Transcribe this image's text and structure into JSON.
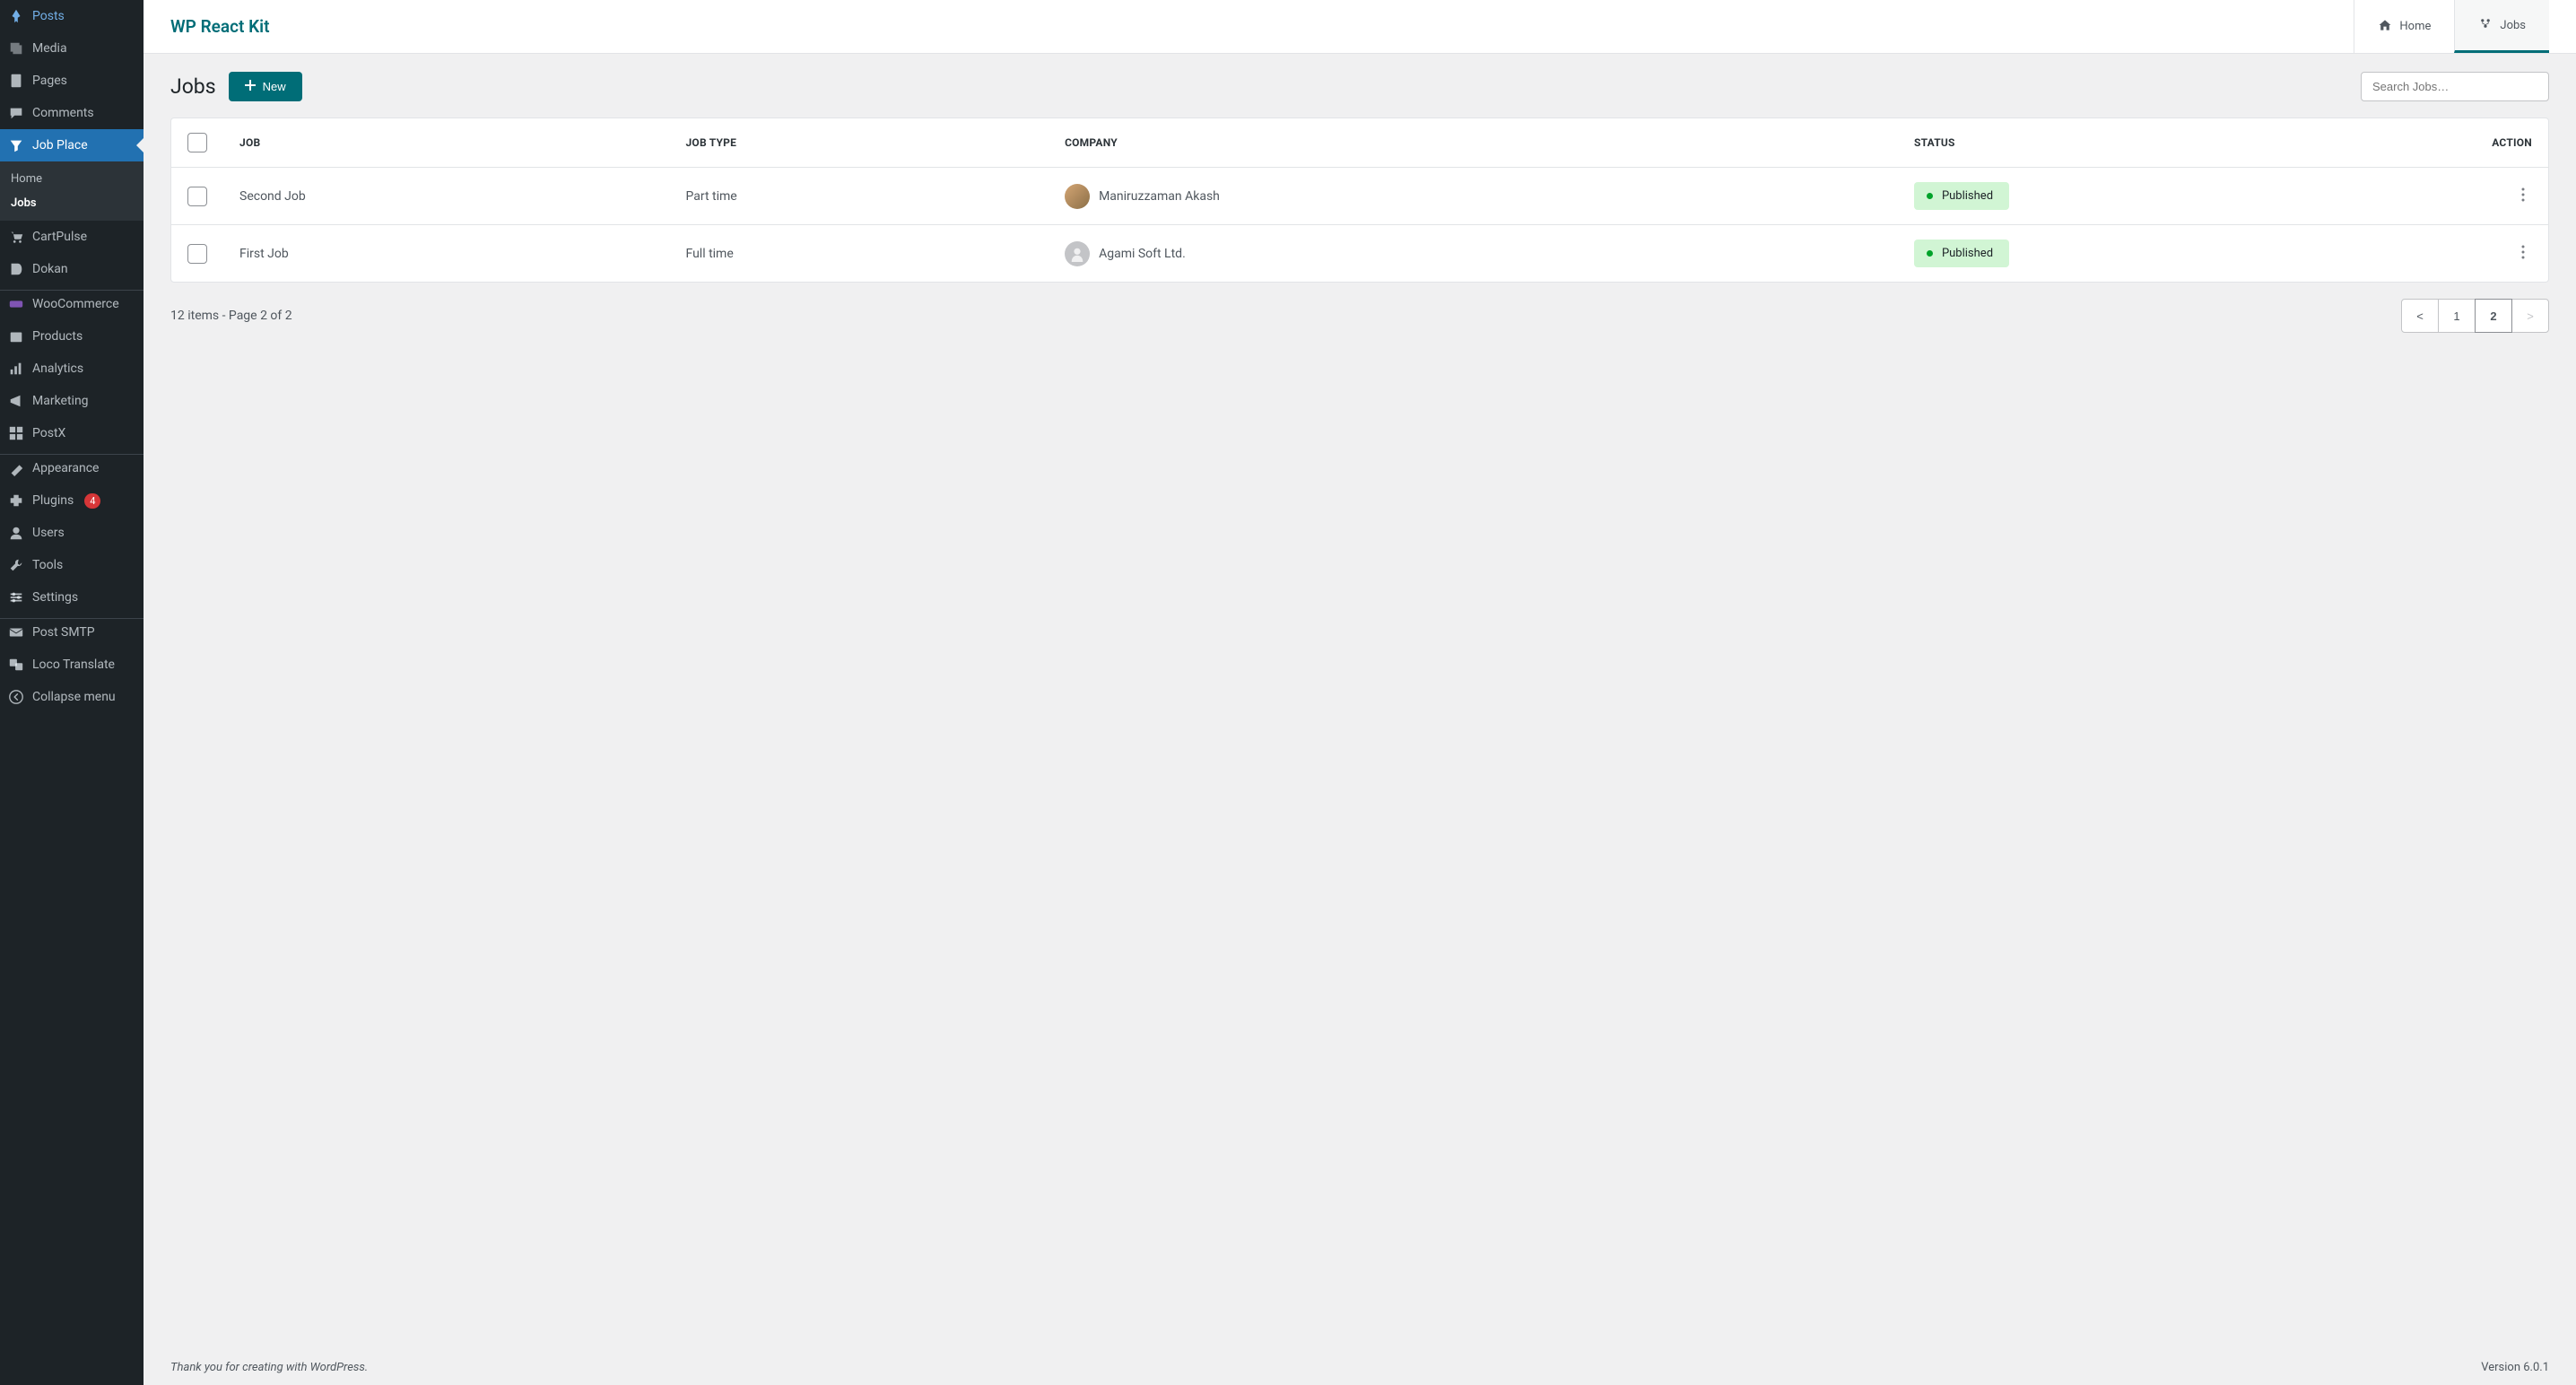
{
  "sidebar": {
    "items": [
      {
        "label": "Posts",
        "icon": "pin"
      },
      {
        "label": "Media",
        "icon": "media"
      },
      {
        "label": "Pages",
        "icon": "page"
      },
      {
        "label": "Comments",
        "icon": "comment"
      },
      {
        "label": "Job Place",
        "icon": "filter",
        "active": true
      },
      {
        "label": "CartPulse",
        "icon": "cart"
      },
      {
        "label": "Dokan",
        "icon": "dokan"
      },
      {
        "label": "WooCommerce",
        "icon": "woo"
      },
      {
        "label": "Products",
        "icon": "product"
      },
      {
        "label": "Analytics",
        "icon": "analytics"
      },
      {
        "label": "Marketing",
        "icon": "marketing"
      },
      {
        "label": "PostX",
        "icon": "postx"
      },
      {
        "label": "Appearance",
        "icon": "appearance"
      },
      {
        "label": "Plugins",
        "icon": "plugin",
        "badge": "4"
      },
      {
        "label": "Users",
        "icon": "user"
      },
      {
        "label": "Tools",
        "icon": "tool"
      },
      {
        "label": "Settings",
        "icon": "settings"
      },
      {
        "label": "Post SMTP",
        "icon": "mail"
      },
      {
        "label": "Loco Translate",
        "icon": "translate"
      },
      {
        "label": "Collapse menu",
        "icon": "collapse"
      }
    ],
    "submenu": [
      {
        "label": "Home"
      },
      {
        "label": "Jobs",
        "active": true
      }
    ]
  },
  "header": {
    "app_title": "WP React Kit",
    "tabs": [
      {
        "label": "Home",
        "icon": "home"
      },
      {
        "label": "Jobs",
        "icon": "jobs",
        "active": true
      }
    ]
  },
  "page": {
    "title": "Jobs",
    "new_button": "New",
    "search_placeholder": "Search Jobs…"
  },
  "table": {
    "columns": {
      "job": "JOB",
      "job_type": "JOB TYPE",
      "company": "COMPANY",
      "status": "STATUS",
      "action": "ACTION"
    },
    "rows": [
      {
        "job": "Second Job",
        "job_type": "Part time",
        "company": "Maniruzzaman Akash",
        "status": "Published",
        "avatar": "photo"
      },
      {
        "job": "First Job",
        "job_type": "Full time",
        "company": "Agami Soft Ltd.",
        "status": "Published",
        "avatar": "default"
      }
    ]
  },
  "pagination": {
    "info": "12 items - Page 2 of 2",
    "prev": "<",
    "pages": [
      "1",
      "2"
    ],
    "current": "2",
    "next": ">"
  },
  "footer": {
    "thanks": "Thank you for creating with WordPress.",
    "version": "Version 6.0.1"
  }
}
